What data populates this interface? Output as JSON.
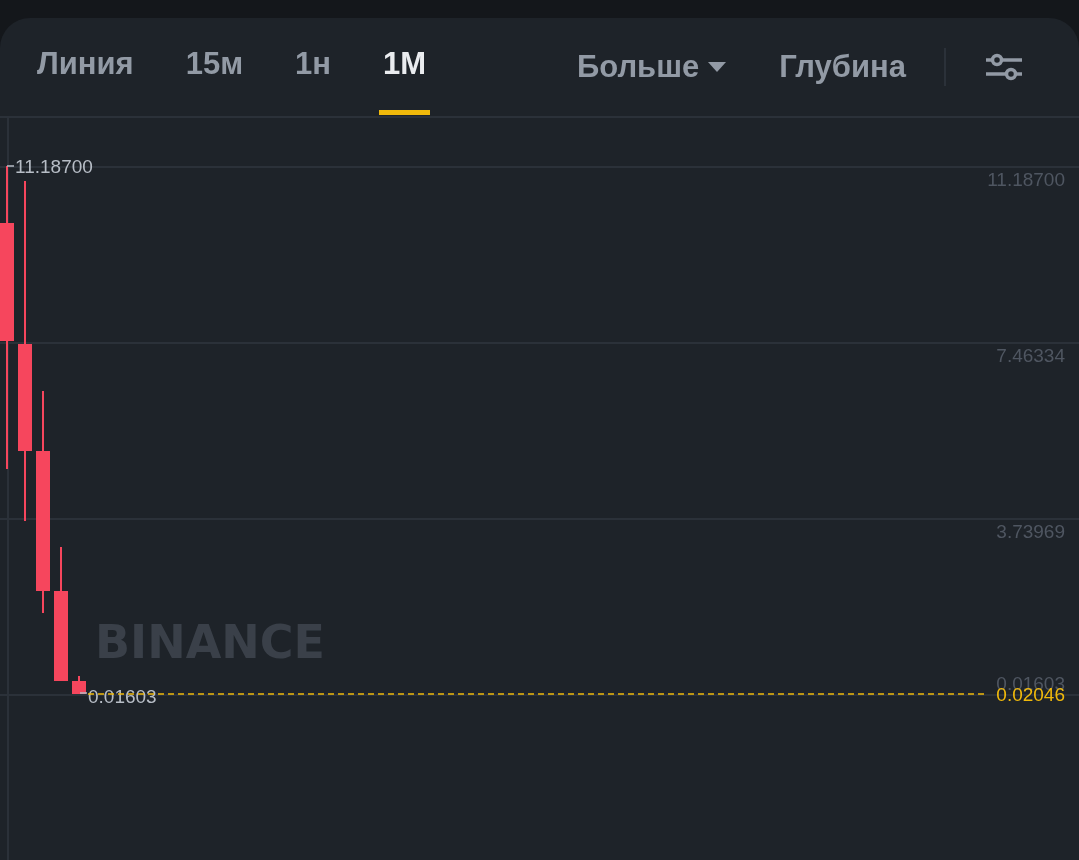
{
  "tabs": [
    {
      "label": "Линия",
      "selected": false
    },
    {
      "label": "15м",
      "selected": false
    },
    {
      "label": "1н",
      "selected": false
    },
    {
      "label": "1М",
      "selected": true
    }
  ],
  "more": {
    "label": "Больше"
  },
  "depth": {
    "label": "Глубина"
  },
  "chart": {
    "watermark": "BINANCE",
    "high_label": "11.18700",
    "low_label": "0.01603",
    "y_axis_labels": [
      "11.18700",
      "7.46334",
      "3.73969",
      "0.01603"
    ],
    "last_price": "0.02046"
  }
}
